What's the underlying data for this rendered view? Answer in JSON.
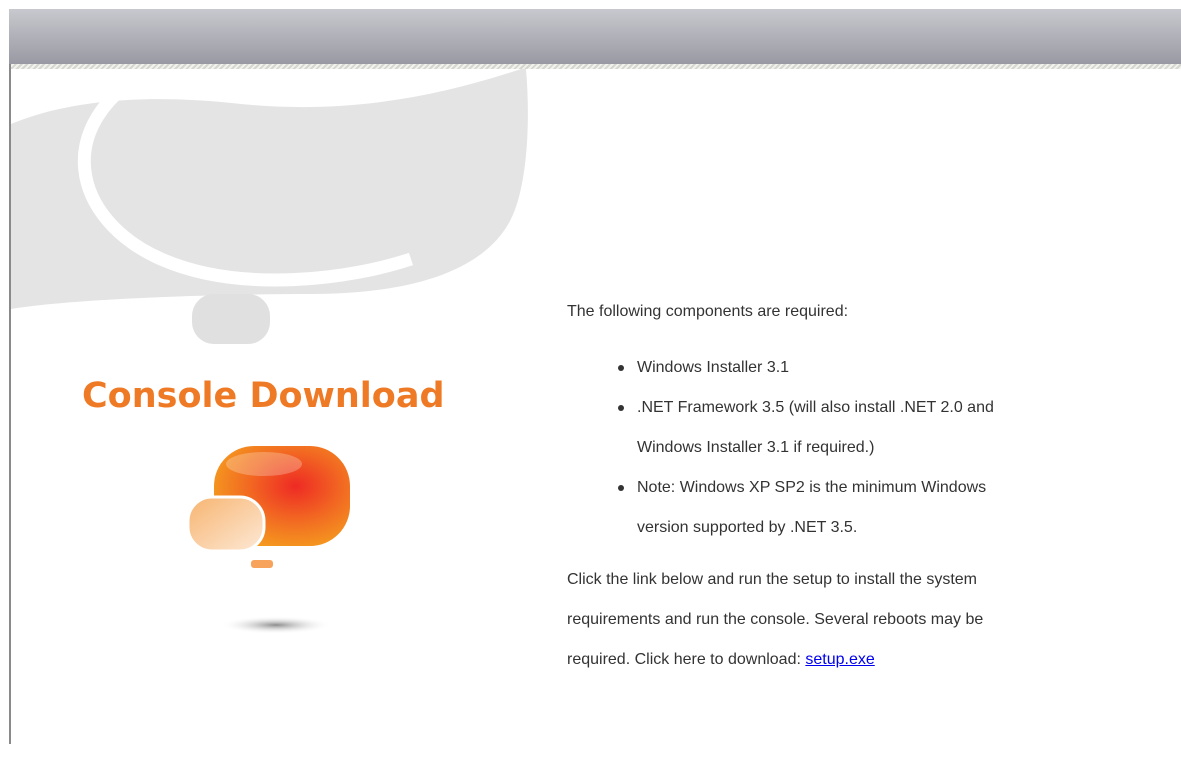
{
  "page": {
    "title": "Console Download"
  },
  "content": {
    "intro": "The following components are required:",
    "requirements": [
      "Windows Installer 3.1",
      ".NET Framework 3.5 (will also install .NET 2.0 and",
      "Windows Installer 3.1 if required.)",
      "Note: Windows XP SP2 is the minimum Windows",
      "version supported by .NET 3.5."
    ],
    "instructions_line1": "Click the link below and run the setup to install the system",
    "instructions_line2": "requirements and run the console. Several reboots may be",
    "instructions_line3": "required. Click here to download: ",
    "download_link": "setup.exe"
  },
  "colors": {
    "title": "#ef7a26",
    "link": "#0000ee",
    "header": "#a5a6ad",
    "background_shape": "#e4e4e4"
  }
}
